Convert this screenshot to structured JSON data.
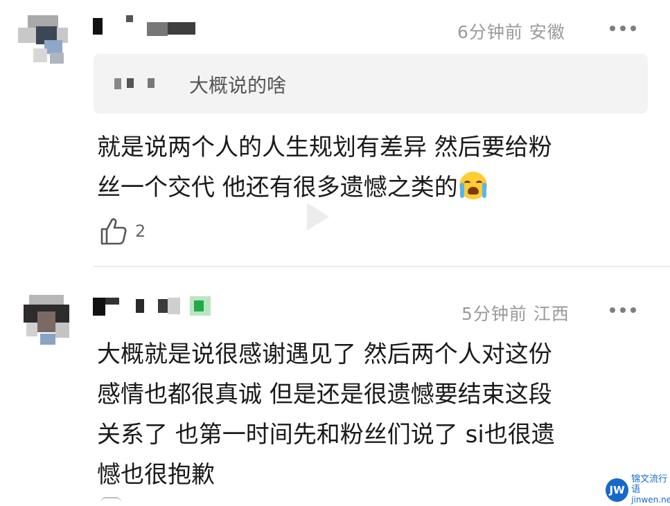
{
  "comments": [
    {
      "meta": {
        "time": "6分钟前",
        "location": "安徽"
      },
      "quote": {
        "text": "大概说的啥"
      },
      "body_lines": [
        "就是说两个人的人生规划有差异 然后要给粉",
        "丝一个交代 他还有很多遗憾之类的"
      ],
      "emoji": "loudly-crying-face-icon",
      "likes": "2"
    },
    {
      "meta": {
        "time": "5分钟前",
        "location": "江西"
      },
      "body_lines": [
        "大概就是说很感谢遇见了 然后两个人对这份",
        "感情也都很真诚 但是还是很遗憾要结束这段",
        "关系了 也第一时间先和粉丝们说了 si也很遗",
        "憾也很抱歉"
      ]
    }
  ],
  "watermark": {
    "logo": "JW",
    "cn": "锦文流行语",
    "en": "jinwen.net"
  },
  "colors": {
    "meta": "#9a9a9a",
    "text": "#1a1a1a",
    "quote_bg": "#f3f3f3",
    "watermark": "#1769c7"
  },
  "icons": [
    "pixelated-avatar-icon",
    "more-dots-icon",
    "thumbs-up-icon",
    "play-icon",
    "jw-logo-icon"
  ]
}
